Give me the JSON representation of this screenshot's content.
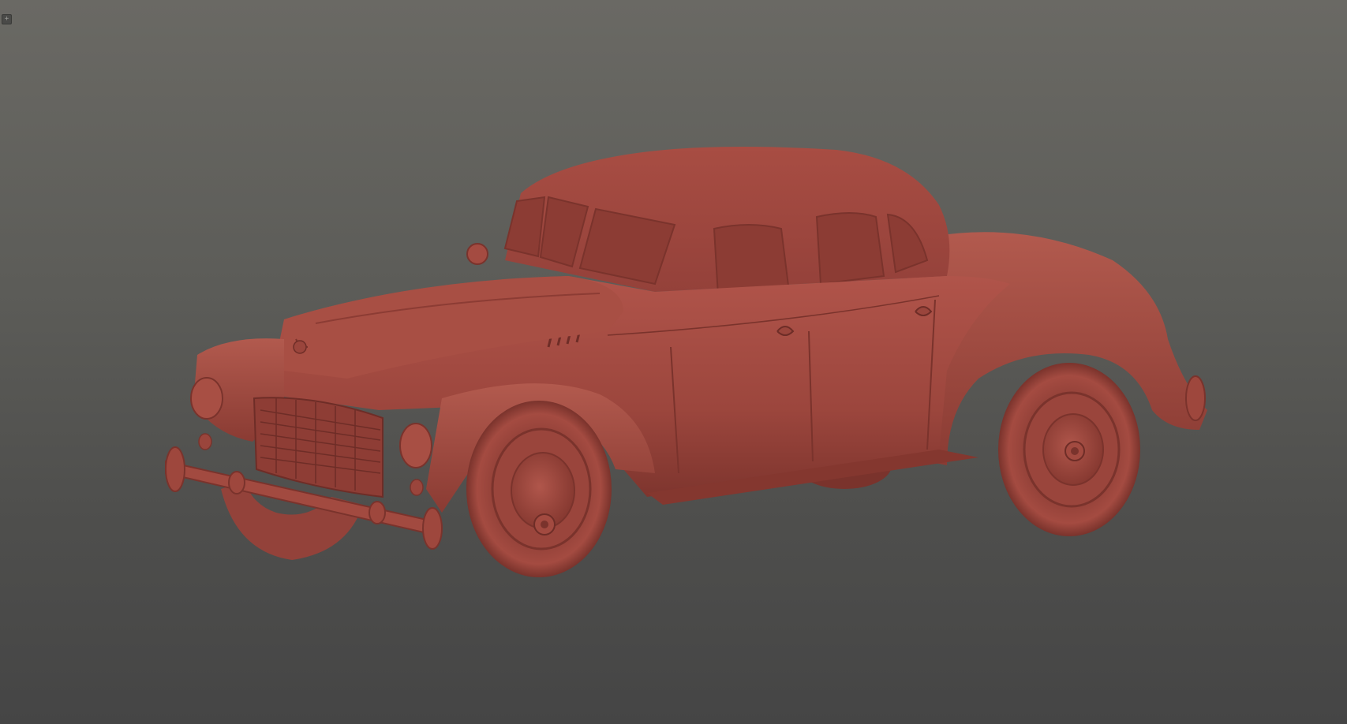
{
  "viewport": {
    "corner_toggle_glyph": "+",
    "background_top": "#6a6964",
    "background_bottom": "#454545"
  },
  "model": {
    "material_color": "#a24a40",
    "material_shadow": "#7a332c",
    "material_highlight": "#b8594d",
    "icon": "vintage-car-clay-model"
  }
}
